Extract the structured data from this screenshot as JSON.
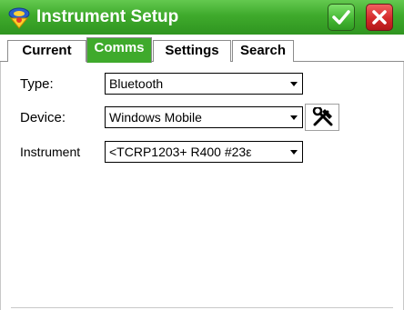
{
  "window": {
    "title": "Instrument Setup",
    "title_icon": "instrument-setup-icon",
    "ok_icon": "checkmark-icon",
    "close_icon": "close-x-icon"
  },
  "tabs": [
    {
      "label": "Current",
      "active": false
    },
    {
      "label": "Comms",
      "active": true
    },
    {
      "label": "Settings",
      "active": false
    },
    {
      "label": "Search",
      "active": false
    }
  ],
  "form": {
    "type": {
      "label": "Type:",
      "value": "Bluetooth"
    },
    "device": {
      "label": "Device:",
      "value": "Windows Mobile",
      "tool_icon": "tools-wrench-hammer-icon"
    },
    "instrument": {
      "label": "Instrument",
      "value": "<TCRP1203+ R400 #23ε"
    }
  },
  "colors": {
    "titlebar": "#3faa2c",
    "active_tab": "#3faa2c",
    "ok_button": "#46b935",
    "close_button": "#d42a2a"
  }
}
